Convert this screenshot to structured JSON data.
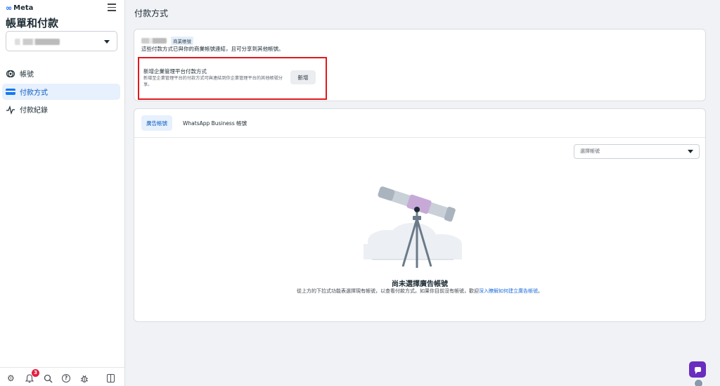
{
  "sidebar": {
    "logo_text": "Meta",
    "title": "帳單和付款",
    "account_select_value": "",
    "items": [
      {
        "label": "帳號",
        "icon": "accounts-icon",
        "active": false
      },
      {
        "label": "付款方式",
        "icon": "credit-card-icon",
        "active": true
      },
      {
        "label": "付款紀錄",
        "icon": "activity-icon",
        "active": false
      }
    ],
    "bottom": {
      "notification_count": "3",
      "icons": [
        "settings-icon",
        "bell-icon",
        "search-icon",
        "help-icon",
        "bug-icon",
        "panel-toggle-icon"
      ]
    }
  },
  "main": {
    "page_title": "付款方式",
    "business_card": {
      "business_tag": "商業帳號",
      "description": "這些付款方式已與你的商業帳號連結，且可分享到其他帳號。",
      "add_section": {
        "title": "新增企業管理平台付款方式",
        "description": "新增至企業管理平台的付款方式可與連結到你企業管理平台的其他帳號分享。",
        "button_label": "新增"
      }
    },
    "tabs": [
      {
        "label": "廣告帳號",
        "active": true
      },
      {
        "label": "WhatsApp Business 帳號",
        "active": false
      }
    ],
    "account_dropdown_placeholder": "選擇帳號",
    "empty_state": {
      "title": "尚未選擇廣告帳號",
      "description_prefix": "從上方的下拉式功能表選擇現有帳號，以查看付款方式。如果你目前沒有帳號，歡迎",
      "link_text": "深入瞭解如何建立廣告帳號",
      "description_suffix": "。"
    }
  },
  "colors": {
    "accent": "#1877f2",
    "active_bg": "#e7f0fd",
    "highlight_border": "#e0191e",
    "chat_button": "#6a2dbf",
    "badge": "#e41e3f"
  }
}
